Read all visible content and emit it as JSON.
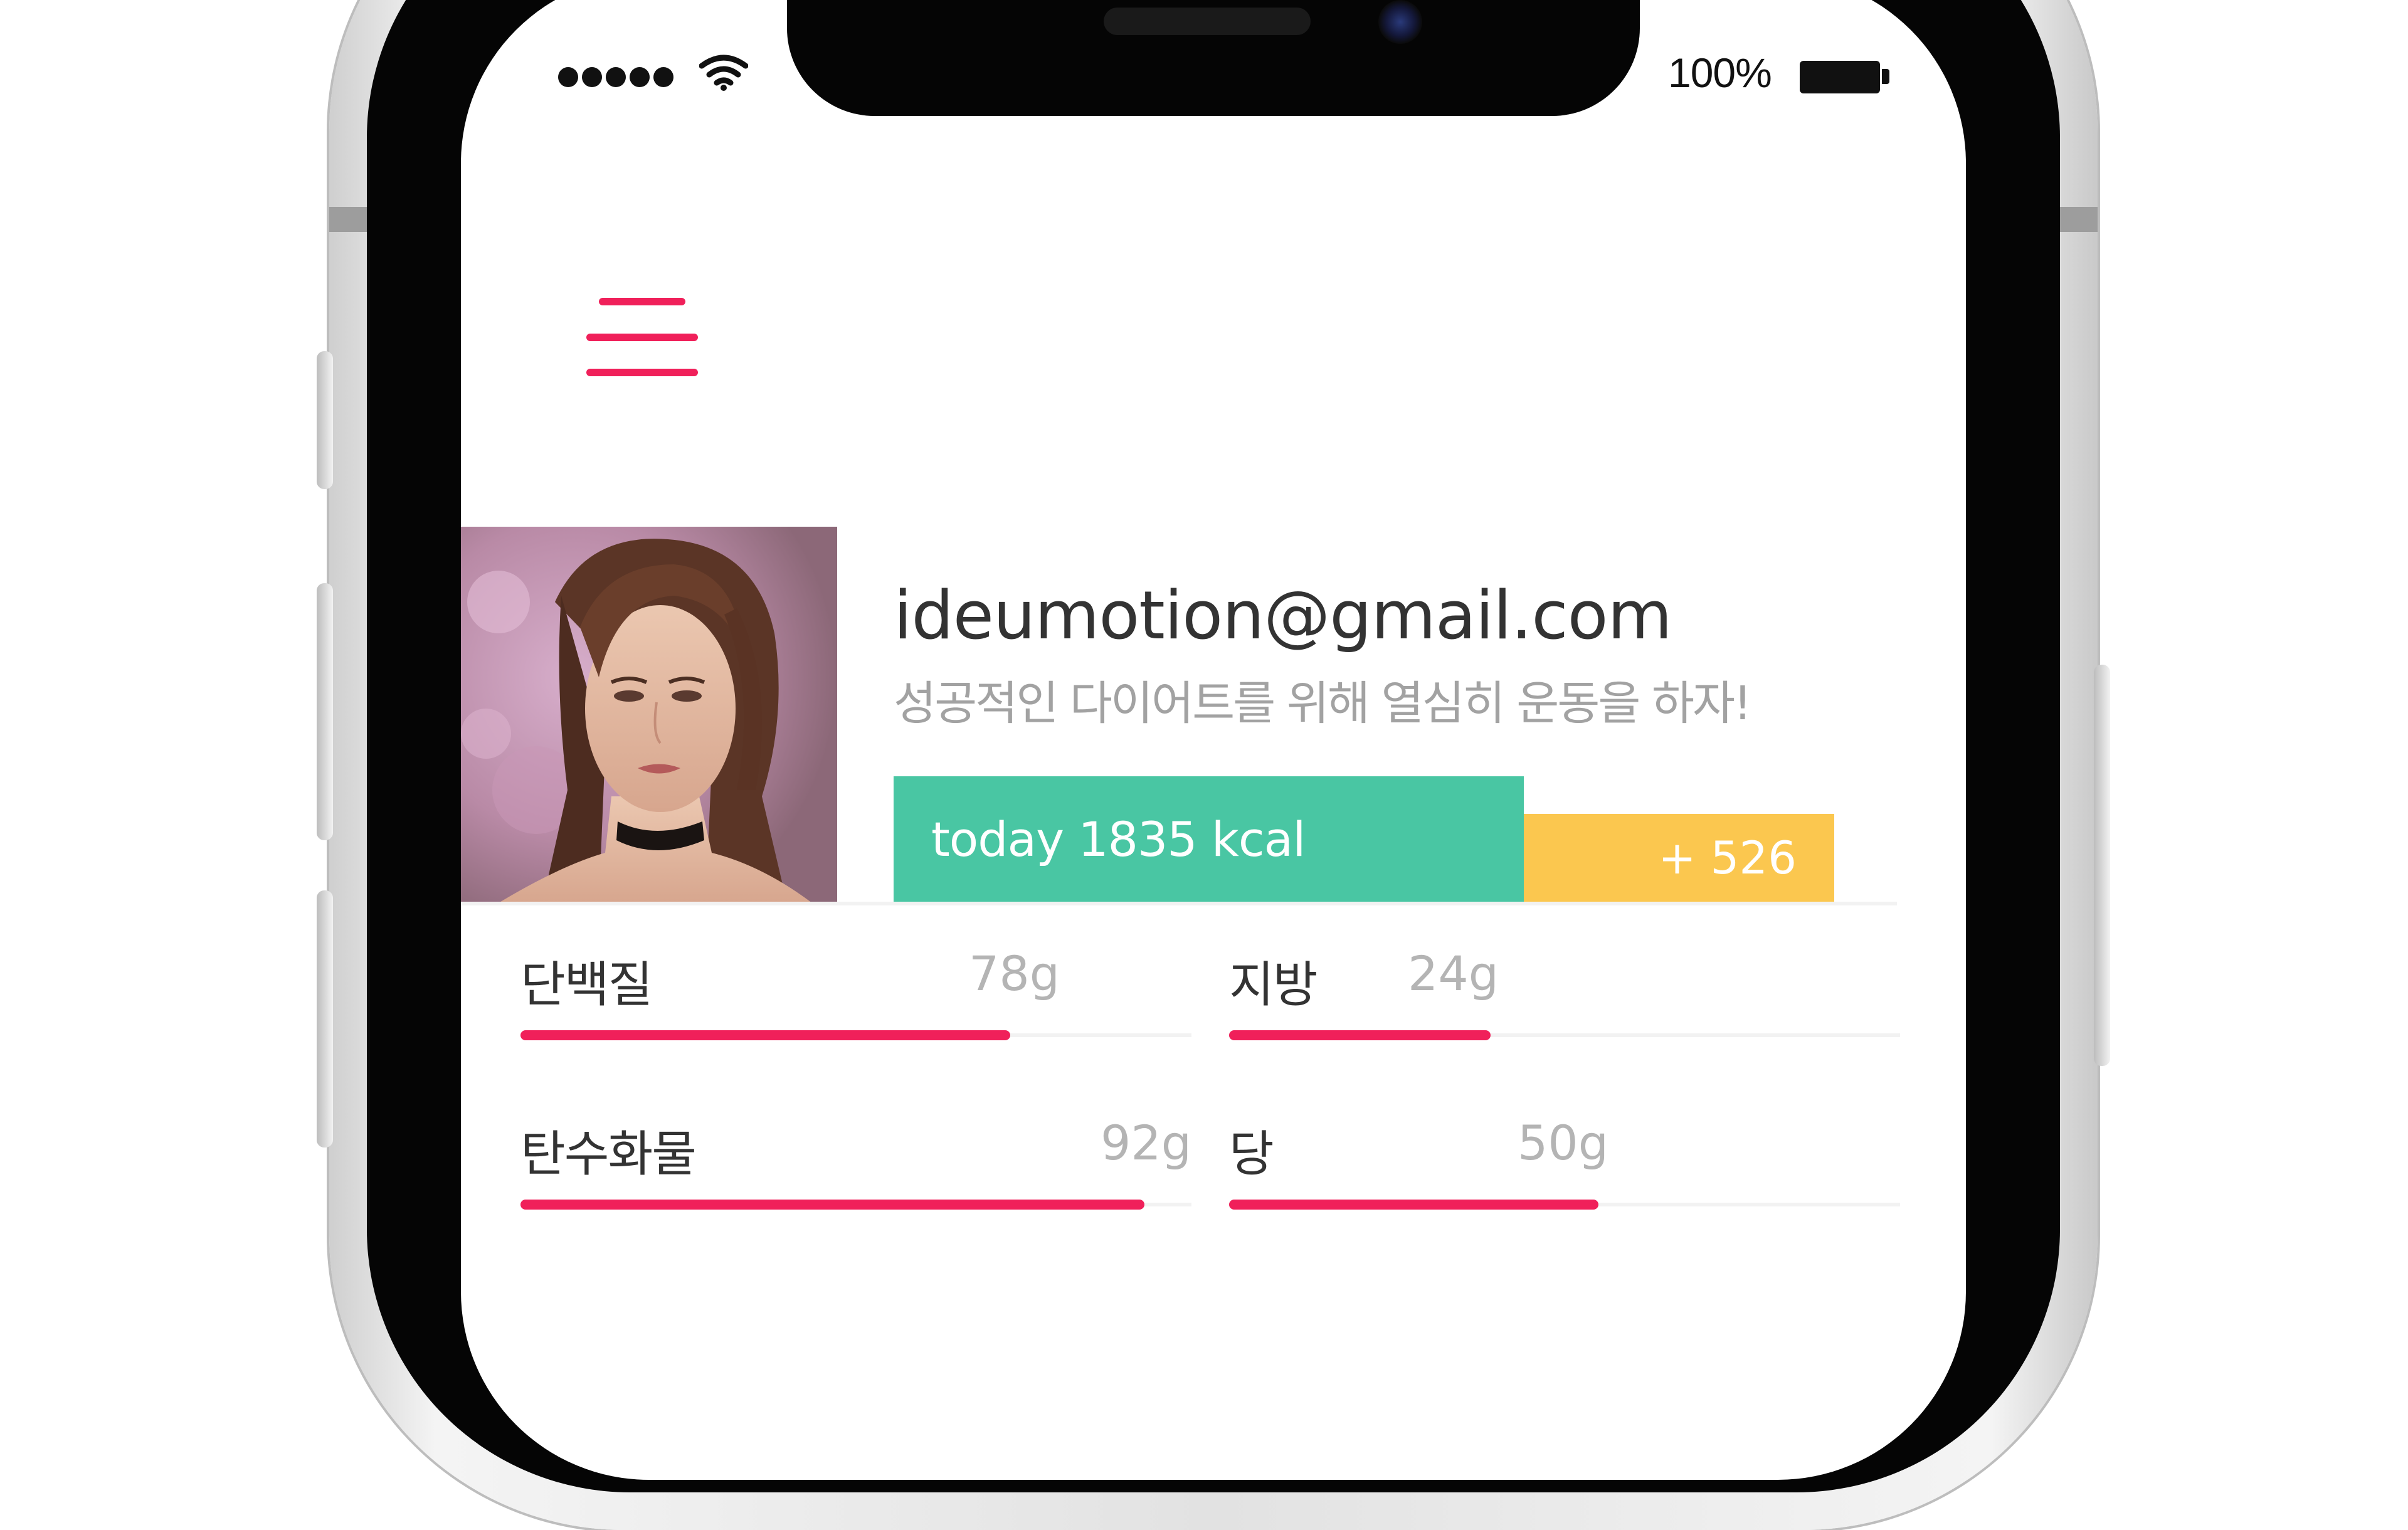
{
  "status_bar": {
    "battery_text": "100%",
    "signal_icon": "signal-dots-icon",
    "wifi_icon": "wifi-icon",
    "battery_icon": "battery-icon"
  },
  "header": {
    "menu_icon": "hamburger-menu-icon"
  },
  "profile": {
    "email": "ideumotion@gmail.com",
    "motto": "성공적인 다이어트를 위해 열심히 운동을 하자!"
  },
  "calories": {
    "today_label": "today 1835 kcal",
    "extra_label": "+ 526"
  },
  "nutrients": [
    {
      "label": "단백질",
      "value": "78g",
      "fill": 0.73
    },
    {
      "label": "지방",
      "value": "24g",
      "fill": 0.39
    },
    {
      "label": "탄수화물",
      "value": "92g",
      "fill": 0.93
    },
    {
      "label": "당",
      "value": "50g",
      "fill": 0.55
    }
  ],
  "colors": {
    "accent": "#f0205a",
    "today_bar": "#49c6a3",
    "extra_bar": "#fbc74f"
  }
}
